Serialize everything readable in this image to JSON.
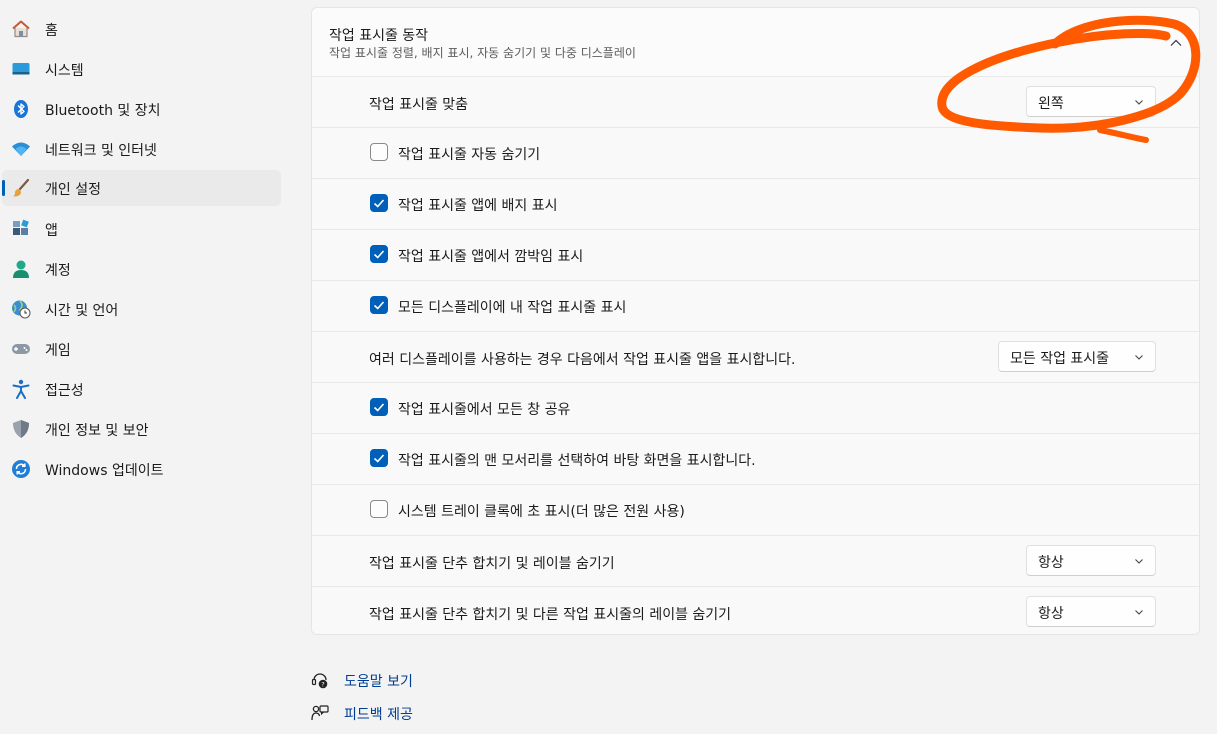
{
  "sidebar": {
    "items": [
      {
        "label": "홈",
        "icon": "home-icon"
      },
      {
        "label": "시스템",
        "icon": "system-icon"
      },
      {
        "label": "Bluetooth 및 장치",
        "icon": "bluetooth-icon"
      },
      {
        "label": "네트워크 및 인터넷",
        "icon": "wifi-icon"
      },
      {
        "label": "개인 설정",
        "icon": "brush-icon",
        "selected": true
      },
      {
        "label": "앱",
        "icon": "apps-icon"
      },
      {
        "label": "계정",
        "icon": "account-icon"
      },
      {
        "label": "시간 및 언어",
        "icon": "time-language-icon"
      },
      {
        "label": "게임",
        "icon": "gamepad-icon"
      },
      {
        "label": "접근성",
        "icon": "accessibility-icon"
      },
      {
        "label": "개인 정보 및 보안",
        "icon": "shield-icon"
      },
      {
        "label": "Windows 업데이트",
        "icon": "update-icon"
      }
    ]
  },
  "section": {
    "title": "작업 표시줄 동작",
    "subtitle": "작업 표시줄 정렬, 배지 표시, 자동 숨기기 및 다중 디스플레이",
    "rows": [
      {
        "type": "dropdown",
        "label": "작업 표시줄 맞춤",
        "value": "왼쪽"
      },
      {
        "type": "checkbox",
        "label": "작업 표시줄 자동 숨기기",
        "checked": false
      },
      {
        "type": "checkbox",
        "label": "작업 표시줄 앱에 배지 표시",
        "checked": true
      },
      {
        "type": "checkbox",
        "label": "작업 표시줄 앱에서 깜박임 표시",
        "checked": true
      },
      {
        "type": "checkbox",
        "label": "모든 디스플레이에 내 작업 표시줄 표시",
        "checked": true
      },
      {
        "type": "dropdown",
        "label": "여러 디스플레이를 사용하는 경우 다음에서 작업 표시줄 앱을 표시합니다.",
        "value": "모든 작업 표시줄"
      },
      {
        "type": "checkbox",
        "label": "작업 표시줄에서 모든 창 공유",
        "checked": true
      },
      {
        "type": "checkbox",
        "label": "작업 표시줄의 맨 모서리를 선택하여 바탕 화면을 표시합니다.",
        "checked": true
      },
      {
        "type": "checkbox",
        "label": "시스템 트레이 클록에 초 표시(더 많은 전원 사용)",
        "checked": false
      },
      {
        "type": "dropdown",
        "label": "작업 표시줄 단추 합치기 및 레이블 숨기기",
        "value": "항상"
      },
      {
        "type": "dropdown",
        "label": "작업 표시줄 단추 합치기 및 다른 작업 표시줄의 레이블 숨기기",
        "value": "항상"
      }
    ]
  },
  "links": {
    "help": "도움말 보기",
    "feedback": "피드백 제공"
  },
  "colors": {
    "accent": "#005fb8",
    "annotation": "#ff5a00",
    "link": "#003e92"
  }
}
